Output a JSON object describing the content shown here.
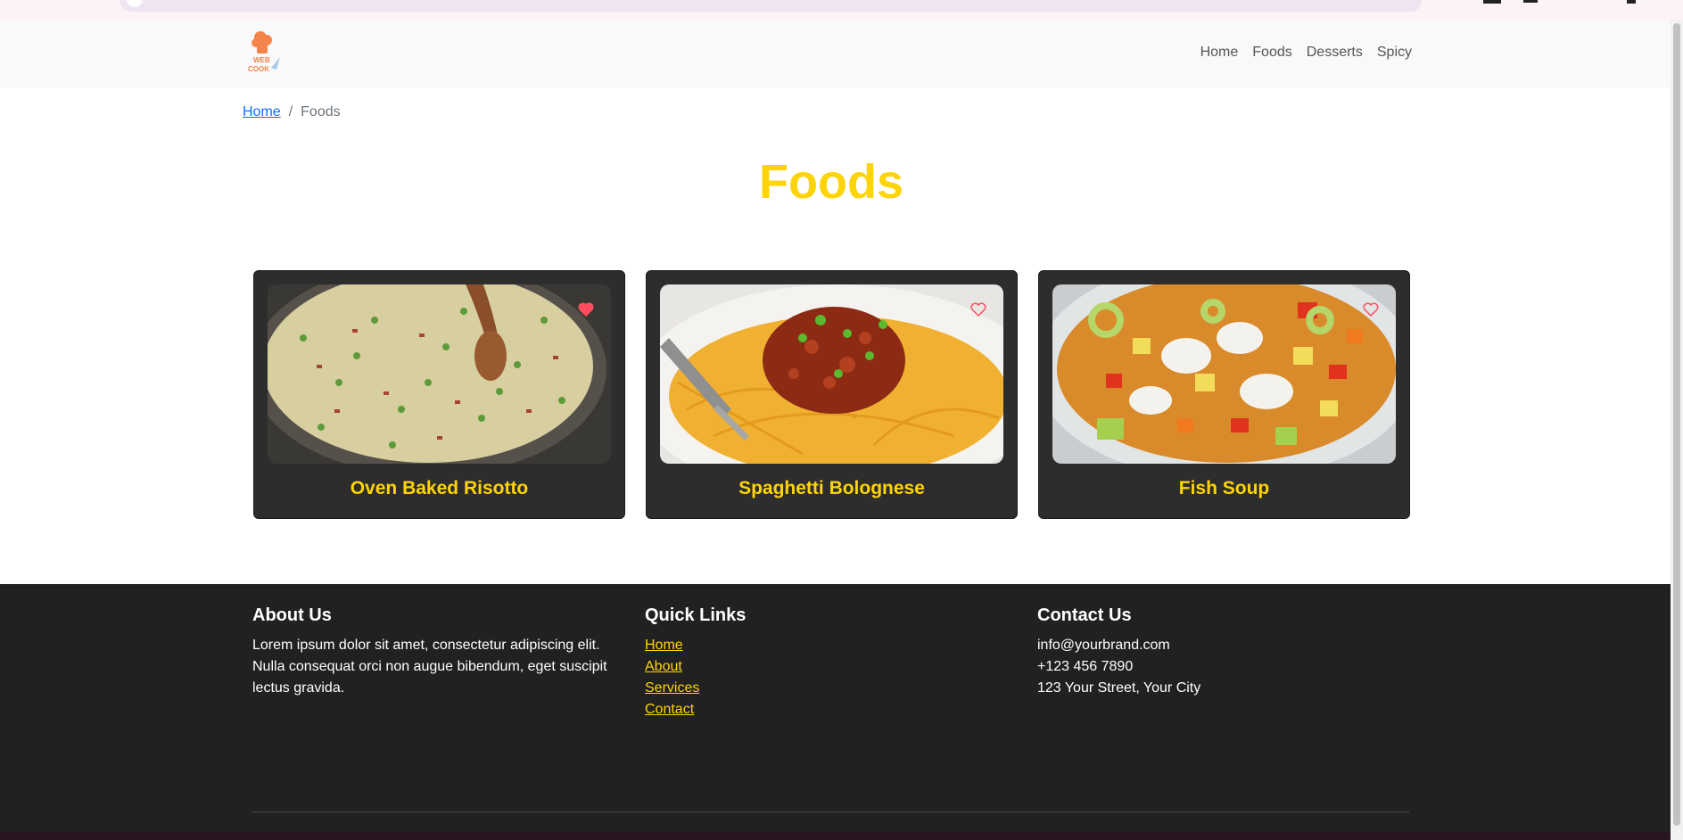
{
  "browser": {
    "address_text": ""
  },
  "navbar": {
    "logo_text_top": "WEB",
    "logo_text_bottom": "COOK",
    "links": [
      "Home",
      "Foods",
      "Desserts",
      "Spicy"
    ]
  },
  "breadcrumb": {
    "home": "Home",
    "separator": "/",
    "current": "Foods"
  },
  "page": {
    "title": "Foods"
  },
  "cards": [
    {
      "title": "Oven Baked Risotto",
      "favorited": true
    },
    {
      "title": "Spaghetti Bolognese",
      "favorited": false
    },
    {
      "title": "Fish Soup",
      "favorited": false
    }
  ],
  "footer": {
    "about": {
      "heading": "About Us",
      "text": "Lorem ipsum dolor sit amet, consectetur adipiscing elit. Nulla consequat orci non augue bibendum, eget suscipit lectus gravida."
    },
    "quick_links": {
      "heading": "Quick Links",
      "links": [
        "Home",
        "About",
        "Services",
        "Contact"
      ]
    },
    "contact": {
      "heading": "Contact Us",
      "email": "info@yourbrand.com",
      "phone": "+123 456 7890",
      "address": "123 Your Street, Your City"
    }
  },
  "colors": {
    "accent": "#fdd408",
    "card_bg": "#2d2d2d",
    "footer_bg": "#212121",
    "heart": "#ff4d5e"
  }
}
